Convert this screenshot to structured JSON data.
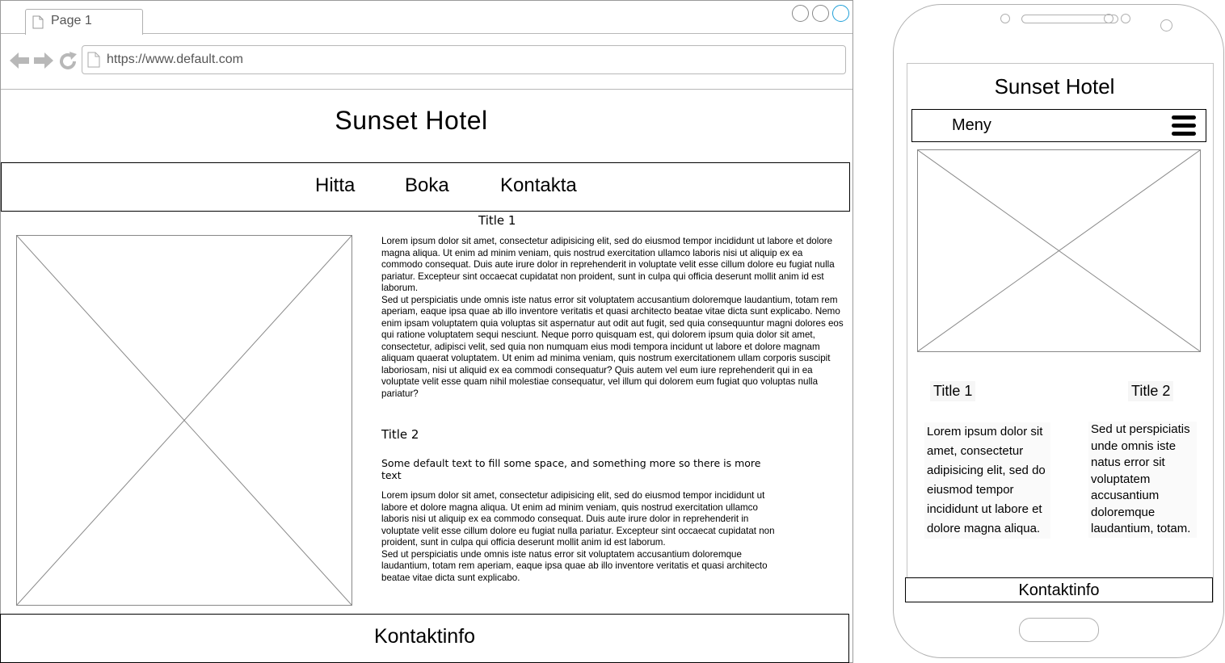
{
  "browser": {
    "tab_label": "Page 1",
    "url": "https://www.default.com"
  },
  "desktop": {
    "site_title": "Sunset Hotel",
    "nav": [
      "Hitta",
      "Boka",
      "Kontakta"
    ],
    "title1": "Title 1",
    "paragraph1": "Lorem ipsum dolor sit amet, consectetur adipisicing elit, sed do eiusmod tempor incididunt ut labore et dolore magna aliqua. Ut enim ad minim veniam, quis nostrud exercitation ullamco laboris nisi ut aliquip ex ea commodo consequat. Duis aute irure dolor in reprehenderit in voluptate velit esse cillum dolore eu fugiat nulla pariatur. Excepteur sint occaecat cupidatat non proident, sunt in culpa qui officia deserunt mollit anim id est laborum.\nSed ut perspiciatis unde omnis iste natus error sit voluptatem accusantium doloremque laudantium, totam rem aperiam, eaque ipsa quae ab illo inventore veritatis et quasi architecto beatae vitae dicta sunt explicabo. Nemo enim ipsam voluptatem quia voluptas sit aspernatur aut odit aut fugit, sed quia consequuntur magni dolores eos qui ratione voluptatem sequi nesciunt. Neque porro quisquam est, qui dolorem ipsum quia dolor sit amet, consectetur, adipisci velit, sed quia non numquam eius modi tempora incidunt ut labore et dolore magnam aliquam quaerat voluptatem. Ut enim ad minima veniam, quis nostrum exercitationem ullam corporis suscipit laboriosam, nisi ut aliquid ex ea commodi consequatur? Quis autem vel eum iure reprehenderit qui in ea voluptate velit esse quam nihil molestiae consequatur, vel illum qui dolorem eum fugiat quo voluptas nulla pariatur?",
    "title2": "Title 2",
    "subtitle": "Some default text to fill some space, and something more so there is more text",
    "paragraph2": "Lorem ipsum dolor sit amet, consectetur adipisicing elit, sed do eiusmod tempor incididunt ut labore et dolore magna aliqua. Ut enim ad minim veniam, quis nostrud exercitation ullamco laboris nisi ut aliquip ex ea commodo consequat. Duis aute irure dolor in reprehenderit in voluptate velit esse cillum dolore eu fugiat nulla pariatur. Excepteur sint occaecat cupidatat non proident, sunt in culpa qui officia deserunt mollit anim id est laborum.\nSed ut perspiciatis unde omnis iste natus error sit voluptatem accusantium doloremque laudantium, totam rem aperiam, eaque ipsa quae ab illo inventore veritatis et quasi architecto beatae vitae dicta sunt explicabo.",
    "footer": "Kontaktinfo"
  },
  "mobile": {
    "site_title": "Sunset Hotel",
    "menu_label": "Meny",
    "col1_title": "Title 1",
    "col2_title": "Title 2",
    "col1_text": "Lorem ipsum dolor sit amet, consectetur adipisicing elit, sed do eiusmod tempor incididunt ut labore et dolore magna aliqua.",
    "col2_text": "Sed ut perspiciatis unde omnis iste natus error sit voluptatem accusantium doloremque laudantium, totam.",
    "footer": "Kontaktinfo"
  },
  "icons": {
    "page": "page-icon",
    "back": "back-arrow-icon",
    "forward": "forward-arrow-icon",
    "reload": "reload-icon",
    "menu": "hamburger-menu-icon",
    "image_placeholder": "image-placeholder-icon"
  }
}
